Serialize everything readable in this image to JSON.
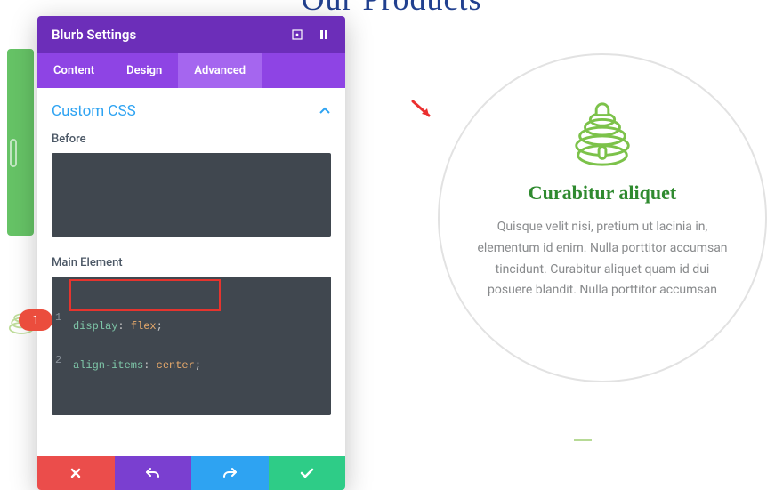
{
  "page": {
    "title": "Our Products"
  },
  "modal": {
    "title": "Blurb Settings",
    "tabs": {
      "content": "Content",
      "design": "Design",
      "advanced": "Advanced"
    },
    "section_title": "Custom CSS",
    "fields": {
      "before": {
        "label": "Before",
        "code": ""
      },
      "main_element": {
        "label": "Main Element",
        "lines": [
          {
            "n": "1",
            "prop": "display",
            "val": "flex"
          },
          {
            "n": "2",
            "prop": "align-items",
            "val": "center"
          }
        ]
      }
    }
  },
  "annotations": {
    "badge_1": "1"
  },
  "product": {
    "title": "Curabitur aliquet",
    "description": "Quisque velit nisi, pretium ut lacinia in, elementum id enim. Nulla porttitor accumsan tincidunt. Curabitur aliquet quam id dui posuere blandit. Nulla porttitor accumsan"
  }
}
